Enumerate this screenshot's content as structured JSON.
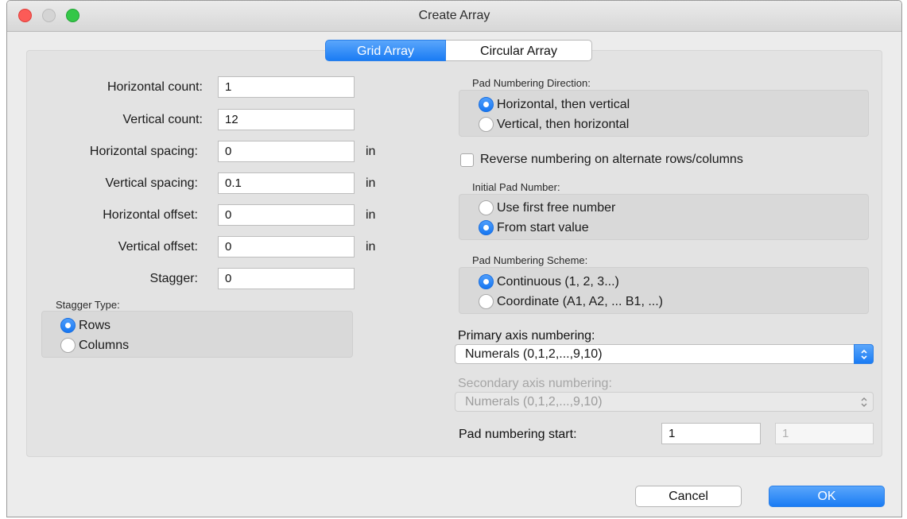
{
  "window": {
    "title": "Create Array"
  },
  "tabs": [
    {
      "label": "Grid Array",
      "selected": true
    },
    {
      "label": "Circular Array",
      "selected": false
    }
  ],
  "grid": {
    "fields": [
      {
        "label": "Horizontal count:",
        "value": "1",
        "unit": ""
      },
      {
        "label": "Vertical count:",
        "value": "12",
        "unit": ""
      },
      {
        "label": "Horizontal spacing:",
        "value": "0",
        "unit": "in"
      },
      {
        "label": "Vertical spacing:",
        "value": "0.1",
        "unit": "in"
      },
      {
        "label": "Horizontal offset:",
        "value": "0",
        "unit": "in"
      },
      {
        "label": "Vertical offset:",
        "value": "0",
        "unit": "in"
      },
      {
        "label": "Stagger:",
        "value": "0",
        "unit": ""
      }
    ],
    "stagger_type": {
      "title": "Stagger Type:",
      "options": [
        {
          "label": "Rows",
          "selected": true
        },
        {
          "label": "Columns",
          "selected": false
        }
      ]
    }
  },
  "numbering": {
    "direction": {
      "title": "Pad Numbering Direction:",
      "options": [
        {
          "label": "Horizontal, then vertical",
          "selected": true
        },
        {
          "label": "Vertical, then horizontal",
          "selected": false
        }
      ]
    },
    "reverse": {
      "label": "Reverse numbering on alternate rows/columns",
      "checked": false
    },
    "initial": {
      "title": "Initial Pad Number:",
      "options": [
        {
          "label": "Use first free number",
          "selected": false
        },
        {
          "label": "From start value",
          "selected": true
        }
      ]
    },
    "scheme": {
      "title": "Pad Numbering Scheme:",
      "options": [
        {
          "label": "Continuous (1, 2, 3...)",
          "selected": true
        },
        {
          "label": "Coordinate (A1, A2, ... B1, ...)",
          "selected": false
        }
      ]
    },
    "primary_axis": {
      "label": "Primary axis numbering:",
      "value": "Numerals (0,1,2,...,9,10)"
    },
    "secondary_axis": {
      "label": "Secondary axis numbering:",
      "value": "Numerals (0,1,2,...,9,10)"
    },
    "start": {
      "label": "Pad numbering start:",
      "value1": "1",
      "value2": "1"
    }
  },
  "buttons": {
    "cancel": "Cancel",
    "ok": "OK"
  },
  "colors": {
    "accent": "#1a7cf4",
    "panel": "#e3e3e3",
    "window": "#ececec"
  }
}
